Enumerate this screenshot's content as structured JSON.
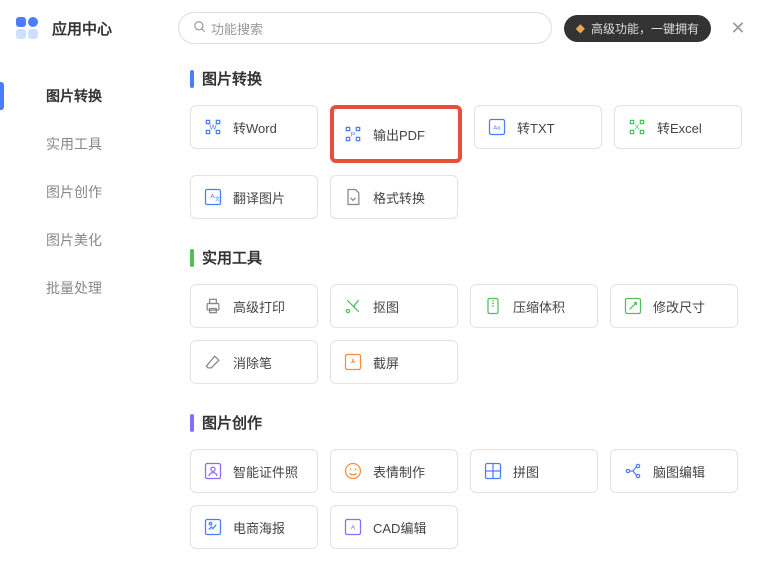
{
  "header": {
    "app_title": "应用中心",
    "search_placeholder": "功能搜索",
    "premium_text": "高级功能，一键拥有"
  },
  "sidebar": {
    "items": [
      {
        "label": "图片转换",
        "active": true
      },
      {
        "label": "实用工具",
        "active": false
      },
      {
        "label": "图片创作",
        "active": false
      },
      {
        "label": "图片美化",
        "active": false
      },
      {
        "label": "批量处理",
        "active": false
      }
    ]
  },
  "sections": [
    {
      "title": "图片转换",
      "bar_color": "#4a7eff",
      "tiles": [
        {
          "label": "转Word",
          "icon": "word",
          "highlight": false
        },
        {
          "label": "输出PDF",
          "icon": "pdf",
          "highlight": true
        },
        {
          "label": "转TXT",
          "icon": "txt",
          "highlight": false
        },
        {
          "label": "转Excel",
          "icon": "excel",
          "highlight": false
        },
        {
          "label": "翻译图片",
          "icon": "translate",
          "highlight": false
        },
        {
          "label": "格式转换",
          "icon": "format",
          "highlight": false
        }
      ]
    },
    {
      "title": "实用工具",
      "bar_color": "#4fbf5a",
      "tiles": [
        {
          "label": "高级打印",
          "icon": "print",
          "highlight": false
        },
        {
          "label": "抠图",
          "icon": "cutout",
          "highlight": false
        },
        {
          "label": "压缩体积",
          "icon": "compress",
          "highlight": false
        },
        {
          "label": "修改尺寸",
          "icon": "resize",
          "highlight": false
        },
        {
          "label": "消除笔",
          "icon": "erase",
          "highlight": false
        },
        {
          "label": "截屏",
          "icon": "screenshot",
          "highlight": false
        }
      ]
    },
    {
      "title": "图片创作",
      "bar_color": "#8a6bff",
      "tiles": [
        {
          "label": "智能证件照",
          "icon": "idphoto",
          "highlight": false
        },
        {
          "label": "表情制作",
          "icon": "emoji",
          "highlight": false
        },
        {
          "label": "拼图",
          "icon": "collage",
          "highlight": false
        },
        {
          "label": "脑图编辑",
          "icon": "mindmap",
          "highlight": false
        },
        {
          "label": "电商海报",
          "icon": "poster",
          "highlight": false
        },
        {
          "label": "CAD编辑",
          "icon": "cad",
          "highlight": false
        }
      ]
    }
  ],
  "icons": {
    "word": "#4a7eff",
    "pdf": "#4a7eff",
    "txt": "#4a7eff",
    "excel": "#4fbf5a",
    "translate": "#4a7eff",
    "format": "#888",
    "print": "#888",
    "cutout": "#4fbf5a",
    "compress": "#4fbf5a",
    "resize": "#4fbf5a",
    "erase": "#888",
    "screenshot": "#ff8a3d",
    "idphoto": "#8a6bff",
    "emoji": "#ff8a3d",
    "collage": "#4a7eff",
    "mindmap": "#4a7eff",
    "poster": "#4a7eff",
    "cad": "#8a6bff"
  }
}
